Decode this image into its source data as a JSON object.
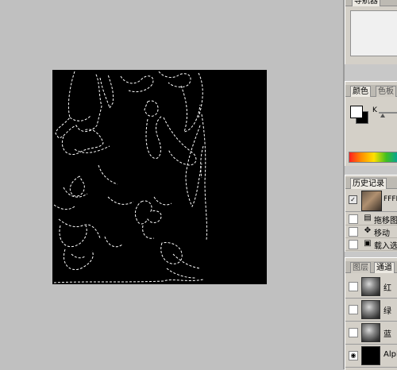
{
  "navigator": {
    "tab_label": "导航器"
  },
  "color": {
    "tabs": [
      "颜色",
      "色板"
    ],
    "slider_label": "K"
  },
  "history": {
    "tab_label": "历史记录",
    "snapshot_label": "FFFFF",
    "items": [
      {
        "label": "拖移图",
        "icon": "paste-icon"
      },
      {
        "label": "移动",
        "icon": "move-tool-icon"
      },
      {
        "label": "载入选",
        "icon": "load-selection-icon"
      }
    ]
  },
  "channels": {
    "tabs": [
      "图层",
      "通道"
    ],
    "items": [
      {
        "label": "红",
        "visible": false
      },
      {
        "label": "绿",
        "visible": false
      },
      {
        "label": "蓝",
        "visible": false
      },
      {
        "label": "Alpha",
        "visible": true
      }
    ]
  }
}
